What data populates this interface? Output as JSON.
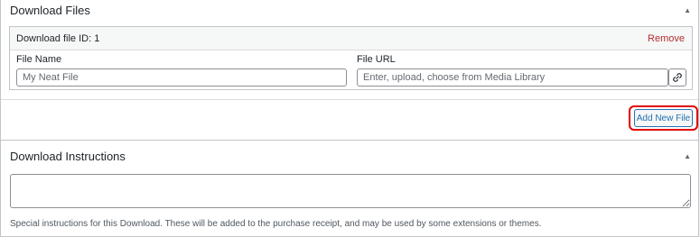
{
  "download_files": {
    "title": "Download Files",
    "toggle_icon": "triangle-up-icon",
    "file_row": {
      "id_label": "Download file ID: 1",
      "remove_label": "Remove",
      "file_name_label": "File Name",
      "file_name_value": "",
      "file_name_placeholder": "My Neat File",
      "file_url_label": "File URL",
      "file_url_value": "",
      "file_url_placeholder": "Enter, upload, choose from Media Library",
      "link_icon": "link-icon"
    },
    "add_button_label": "Add New File"
  },
  "download_instructions": {
    "title": "Download Instructions",
    "toggle_icon": "triangle-up-icon",
    "textarea_value": "",
    "help_text": "Special instructions for this Download. These will be added to the purchase receipt, and may be used by some extensions or themes."
  },
  "colors": {
    "accent": "#2271b1",
    "remove": "#b32d2e",
    "highlight": "#e00000"
  }
}
